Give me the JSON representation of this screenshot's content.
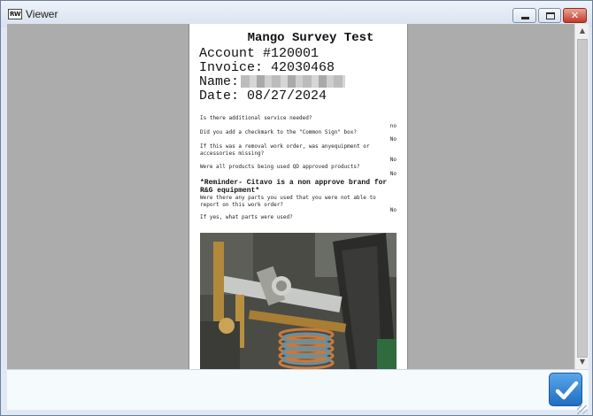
{
  "window": {
    "title": "Viewer",
    "app_icon_text": "RW",
    "close_glyph": "✕"
  },
  "document": {
    "title": "Mango Survey Test",
    "account": "Account #120001",
    "invoice": "Invoice: 42030468",
    "name_label": "Name:",
    "date": "Date: 08/27/2024",
    "questions": [
      {
        "q": "Is there additional service needed?",
        "a": "no"
      },
      {
        "q": "Did you add a checkmark to the \"Common Sign\" box?",
        "a": "No"
      },
      {
        "q": "If this was a removal work order, was anyequipment or accessories missing?",
        "a": "No"
      },
      {
        "q": "Were all products being used QD approved products?",
        "a": "No"
      },
      {
        "q": "Were there any parts you used that you were not able to report on this work order?",
        "a": "No"
      },
      {
        "q": "If yes, what parts were used?",
        "a": ""
      }
    ],
    "reminder": "*Reminder- Citavo is a non approve brand for R&G equipment*"
  },
  "colors": {
    "viewer_bg": "#acacac",
    "accent_button": "#1f6ec2",
    "titlebar": "#dfe8f3"
  },
  "icons": {
    "app": "app-logo-icon",
    "minimize": "minimize-icon",
    "maximize": "maximize-icon",
    "close": "close-icon",
    "confirm": "checkmark-icon"
  }
}
